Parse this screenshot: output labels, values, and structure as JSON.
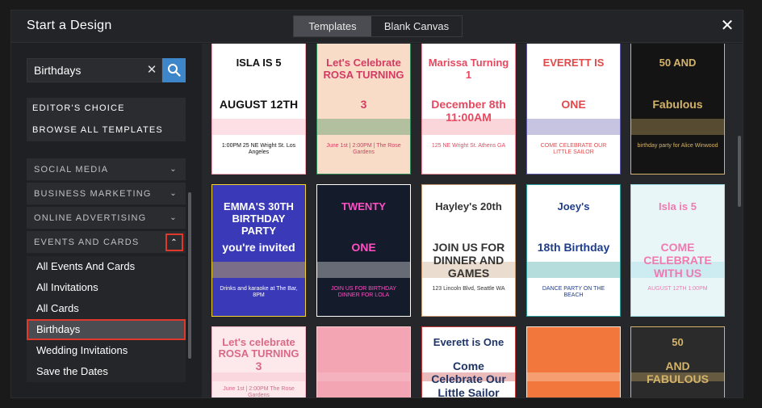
{
  "header": {
    "title": "Start a Design",
    "tabs": [
      {
        "label": "Templates",
        "active": true
      },
      {
        "label": "Blank Canvas",
        "active": false
      }
    ],
    "close_icon": "close-icon"
  },
  "search": {
    "value": "Birthdays",
    "clear_icon": "clear-icon",
    "button_icon": "search-icon"
  },
  "quick_links": [
    "EDITOR'S CHOICE",
    "BROWSE ALL TEMPLATES"
  ],
  "categories": [
    {
      "label": "SOCIAL MEDIA",
      "expanded": false
    },
    {
      "label": "BUSINESS MARKETING",
      "expanded": false
    },
    {
      "label": "ONLINE ADVERTISING",
      "expanded": false
    },
    {
      "label": "EVENTS AND CARDS",
      "expanded": true
    }
  ],
  "subcategories": [
    {
      "label": "All Events And Cards",
      "selected": false
    },
    {
      "label": "All Invitations",
      "selected": false
    },
    {
      "label": "All Cards",
      "selected": false
    },
    {
      "label": "Birthdays",
      "selected": true
    },
    {
      "label": "Wedding Invitations",
      "selected": false
    },
    {
      "label": "Save the Dates",
      "selected": false
    }
  ],
  "templates": [
    {
      "t1": "ISLA IS 5",
      "t2": "AUGUST 12TH",
      "t3": "1:00PM 25 NE Wright St. Los Angeles",
      "bg": "#ffffff",
      "c": "#111111",
      "accent": "#f6a6b4"
    },
    {
      "t1": "Let's Celebrate ROSA TURNING",
      "t2": "3",
      "t3": "June 1st | 2:00PM | The Rose Gardens",
      "bg": "#f9dcc8",
      "c": "#d43b63",
      "accent": "#2e8b57"
    },
    {
      "t1": "Marissa Turning 1",
      "t2": "December 8th 11:00AM",
      "t3": "125 NE Wright St. Athens GA",
      "bg": "#ffffff",
      "c": "#e8485f",
      "accent": "#f08a98"
    },
    {
      "t1": "EVERETT IS",
      "t2": "ONE",
      "t3": "COME CELEBRATE OUR LITTLE SAILOR",
      "bg": "#ffffff",
      "c": "#e04a4a",
      "accent": "#5b57a6"
    },
    {
      "t1": "50 AND",
      "t2": "Fabulous",
      "t3": "birthday party for Alice Winwood",
      "bg": "#141414",
      "c": "#d4b36a",
      "accent": "#d4b36a"
    },
    {
      "t1": "EMMA'S 30TH BIRTHDAY PARTY",
      "t2": "you're invited",
      "t3": "Drinks and karaoke at The Bar, 8PM",
      "bg": "#3a3ab8",
      "c": "#ffffff",
      "accent": "#f3d232"
    },
    {
      "t1": "TWENTY",
      "t2": "ONE",
      "t3": "JOIN US FOR BIRTHDAY DINNER FOR LOLA",
      "bg": "#141c2c",
      "c": "#ff4fc3",
      "accent": "#ffffff"
    },
    {
      "t1": "Hayley's 20th",
      "t2": "JOIN US FOR DINNER AND GAMES",
      "t3": "123 Lincoln Blvd, Seattle WA",
      "bg": "#ffffff",
      "c": "#333333",
      "accent": "#c49a74"
    },
    {
      "t1": "Joey's",
      "t2": "18th Birthday",
      "t3": "DANCE PARTY ON THE BEACH",
      "bg": "#ffffff",
      "c": "#1f3e8a",
      "accent": "#2a9d9b"
    },
    {
      "t1": "Isla is 5",
      "t2": "COME CELEBRATE WITH US",
      "t3": "AUGUST 12TH 1:00PM",
      "bg": "#e9f6f8",
      "c": "#f07ab0",
      "accent": "#9ad9e6"
    },
    {
      "t1": "Let's celebrate ROSA TURNING",
      "t2": "3",
      "t3": "June 1st | 2:00PM The Rose Gardens",
      "bg": "#fde8ec",
      "c": "#d96a86",
      "accent": "#f3b7c5"
    },
    {
      "t1": "",
      "t2": "",
      "t3": "",
      "bg": "#f3a5b4",
      "c": "#ffffff",
      "accent": "#f7c9d1"
    },
    {
      "t1": "Everett is One",
      "t2": "Come Celebrate Our Little Sailor",
      "t3": "",
      "bg": "#ffffff",
      "c": "#1f3566",
      "accent": "#c63a3a"
    },
    {
      "t1": "",
      "t2": "",
      "t3": "",
      "bg": "#f2773c",
      "c": "#ffffff",
      "accent": "#fbe7d7"
    },
    {
      "t1": "50",
      "t2": "AND FABULOUS",
      "t3": "",
      "bg": "#2b2b2b",
      "c": "#d4b36a",
      "accent": "#d4b36a"
    }
  ]
}
